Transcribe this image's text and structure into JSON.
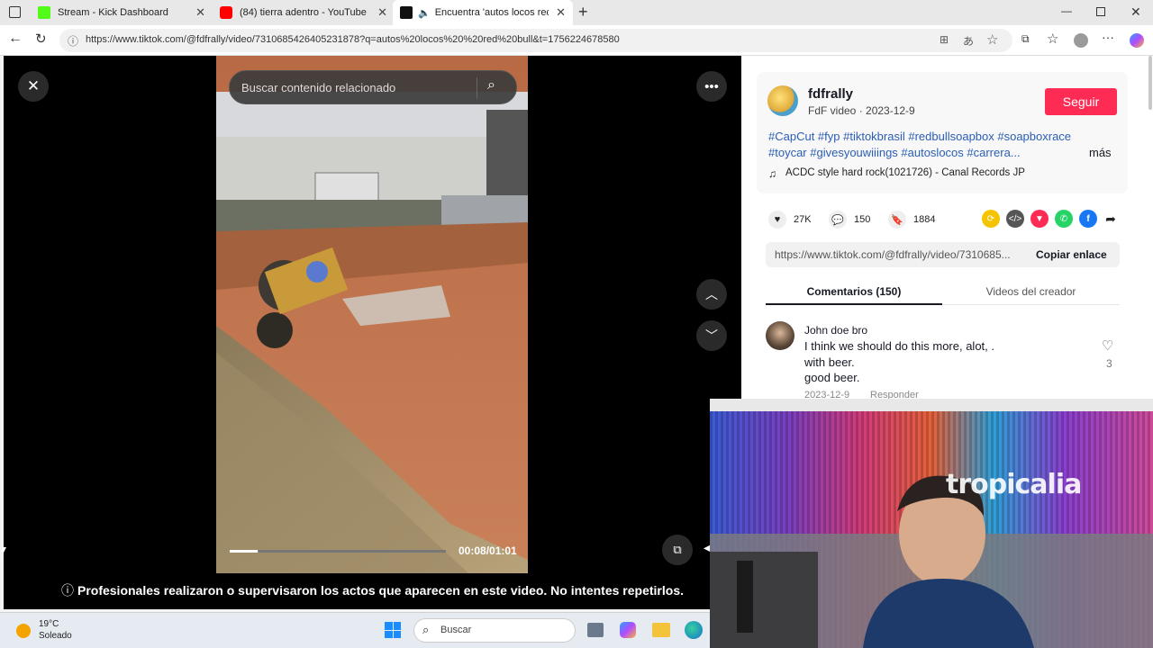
{
  "browser": {
    "tabs": [
      {
        "label": "Stream - Kick Dashboard",
        "icon": "kick-icon"
      },
      {
        "label": "(84) tierra adentro - YouTube",
        "icon": "youtube-icon"
      },
      {
        "label": "Encuentra 'autos locos red b",
        "icon": "tiktok-icon"
      }
    ],
    "url": "https://www.tiktok.com/@fdfrally/video/7310685426405231878?q=autos%20locos%20%20red%20bull&t=1756224678580"
  },
  "video": {
    "search_placeholder": "Buscar contenido relacionado",
    "time": "00:08/01:01",
    "progress": 0.13,
    "warning": "Profesionales realizaron o supervisaron los actos que aparecen en este video. No intentes repetirlos."
  },
  "creator": {
    "name": "fdfrally",
    "subtitle": "FdF video · 2023-12-9",
    "follow_label": "Seguir",
    "caption_line1": "#CapCut #fyp #tiktokbrasil #redbullsoapbox #soapboxrace",
    "caption_line2": "#toycar #givesyouwiiings #autoslocos #carrera...",
    "more_label": "más",
    "music": "ACDC style hard rock(1021726) - Canal Records JP"
  },
  "stats": {
    "likes": "27K",
    "comments": "150",
    "saves": "1884"
  },
  "link": {
    "url": "https://www.tiktok.com/@fdfrally/video/7310685...",
    "copy_label": "Copiar enlace"
  },
  "panel_tabs": {
    "comments": "Comentarios (150)",
    "creator_videos": "Videos del creador"
  },
  "comment": {
    "user": "John doe bro",
    "line1": "I think we should do this more, alot, .",
    "line2": "with beer.",
    "line3": "good beer.",
    "likes": "3",
    "date": "2023-12-9",
    "reply_label": "Responder"
  },
  "webcam": {
    "sign": "tropicalia"
  },
  "taskbar": {
    "temp": "19°C",
    "weather": "Soleado",
    "search_placeholder": "Buscar"
  },
  "colors": {
    "accent": "#fe2c55",
    "hashtag": "#2b5db5"
  }
}
